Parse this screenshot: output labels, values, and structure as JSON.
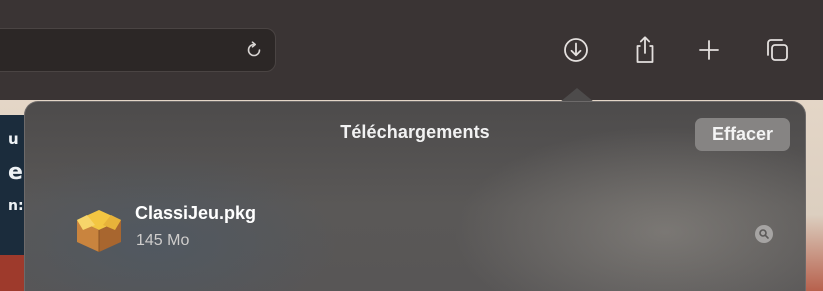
{
  "toolbar": {
    "icons": {
      "reload": "reload-icon",
      "downloads": "downloads-icon",
      "share": "share-icon",
      "new_tab": "plus-icon",
      "tab_overview": "tabs-icon"
    }
  },
  "page_fragments": [
    "u",
    "e",
    "n:"
  ],
  "downloads_popover": {
    "title": "Téléchargements",
    "clear_label": "Effacer",
    "items": [
      {
        "icon": "package-icon",
        "name": "ClassiJeu.pkg",
        "size": "145 Mo",
        "action_icon": "magnifier-icon"
      }
    ]
  },
  "colors": {
    "toolbar": "#3a3434",
    "popover": "#555353",
    "clear_button": "#868483",
    "text_primary": "#ffffff",
    "text_secondary": "#cfcdcc"
  }
}
